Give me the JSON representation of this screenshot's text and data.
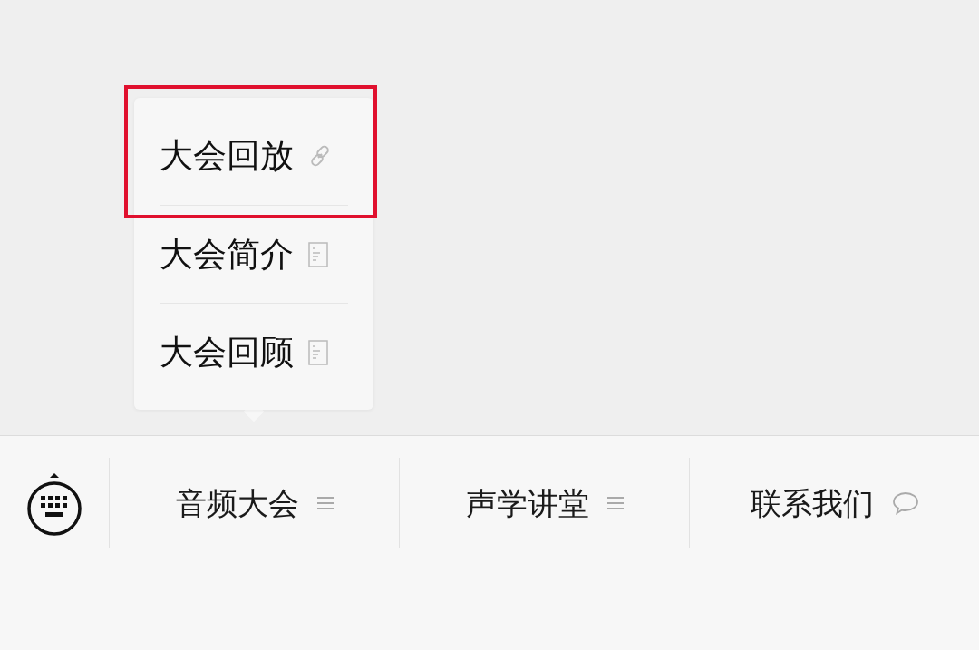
{
  "popup_menu": {
    "items": [
      {
        "label": "大会回放",
        "kind": "link",
        "highlighted": true
      },
      {
        "label": "大会简介",
        "kind": "article",
        "highlighted": false
      },
      {
        "label": "大会回顾",
        "kind": "article",
        "highlighted": false
      }
    ]
  },
  "bottom_menu": {
    "items": [
      {
        "label": "音频大会",
        "kind": "submenu",
        "expanded": true
      },
      {
        "label": "声学讲堂",
        "kind": "submenu",
        "expanded": false
      },
      {
        "label": "联系我们",
        "kind": "chat",
        "expanded": false
      }
    ]
  }
}
